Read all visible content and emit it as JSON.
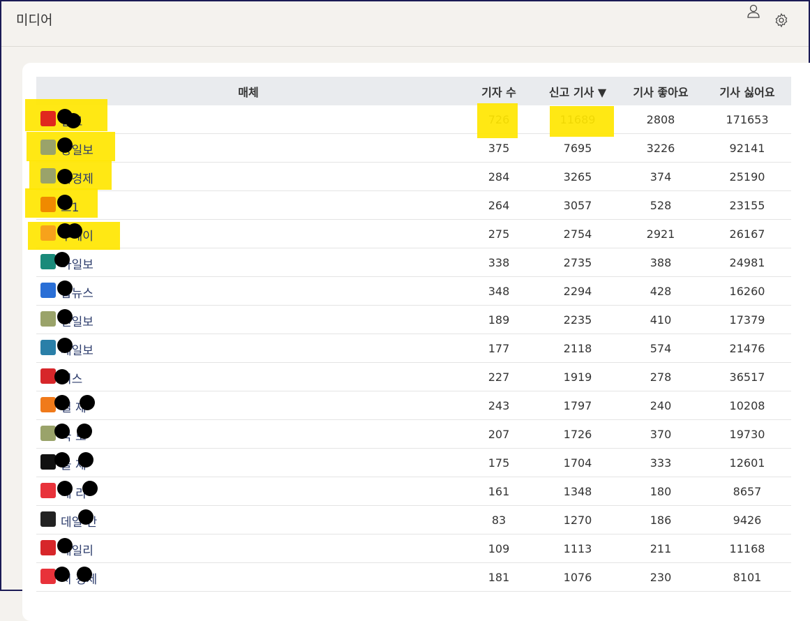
{
  "header": {
    "title": "미디어"
  },
  "table": {
    "columns": [
      "매체",
      "기자 수",
      "신고 기사 ▼",
      "기사 좋아요",
      "기사 싫어요"
    ],
    "rows": [
      {
        "name": "일보",
        "logo_color": "#e0281e",
        "reporters": "726",
        "reports": "11689",
        "likes": "2808",
        "dislikes": "171653"
      },
      {
        "name": "앙일보",
        "logo_color": "#9aa36a",
        "reporters": "375",
        "reports": "7695",
        "likes": "3226",
        "dislikes": "92141"
      },
      {
        "name": "국경제",
        "logo_color": "#9aa36a",
        "reporters": "284",
        "reports": "3265",
        "likes": "374",
        "dislikes": "25190"
      },
      {
        "name": "스1",
        "logo_color": "#f08a00",
        "reporters": "264",
        "reports": "3057",
        "likes": "528",
        "dislikes": "23155"
      },
      {
        "name": "투데이",
        "logo_color": "#f7a21b",
        "reporters": "275",
        "reports": "2754",
        "likes": "2921",
        "dislikes": "26167"
      },
      {
        "name": "아일보",
        "logo_color": "#1a8a7a",
        "reporters": "338",
        "reports": "2735",
        "likes": "388",
        "dislikes": "24981"
      },
      {
        "name": "합뉴스",
        "logo_color": "#2a6fd6",
        "reporters": "348",
        "reports": "2294",
        "likes": "428",
        "dislikes": "16260"
      },
      {
        "name": "민일보",
        "logo_color": "#9aa36a",
        "reporters": "189",
        "reports": "2235",
        "likes": "410",
        "dislikes": "17379"
      },
      {
        "name": "계일보",
        "logo_color": "#2a7fa8",
        "reporters": "177",
        "reports": "2118",
        "likes": "574",
        "dislikes": "21476"
      },
      {
        "name": "시스",
        "logo_color": "#d7262a",
        "reporters": "227",
        "reports": "1919",
        "likes": "278",
        "dislikes": "36517"
      },
      {
        "name": "일 제",
        "logo_color": "#f07a1a",
        "reporters": "243",
        "reports": "1797",
        "likes": "240",
        "dislikes": "10208"
      },
      {
        "name": "국 보",
        "logo_color": "#9aa36a",
        "reporters": "207",
        "reports": "1726",
        "likes": "370",
        "dislikes": "19730"
      },
      {
        "name": "울 제",
        "logo_color": "#111111",
        "reporters": "175",
        "reports": "1704",
        "likes": "333",
        "dislikes": "12601"
      },
      {
        "name": "데 리",
        "logo_color": "#e8323a",
        "reporters": "161",
        "reports": "1348",
        "likes": "180",
        "dislikes": "8657"
      },
      {
        "name": "데일 안",
        "logo_color": "#222222",
        "reporters": "83",
        "reports": "1270",
        "likes": "186",
        "dislikes": "9426"
      },
      {
        "name": "데일리",
        "logo_color": "#d7262a",
        "reporters": "109",
        "reports": "1113",
        "likes": "211",
        "dislikes": "11168"
      },
      {
        "name": "시 경제",
        "logo_color": "#e8323a",
        "reporters": "181",
        "reports": "1076",
        "likes": "230",
        "dislikes": "8101"
      }
    ]
  },
  "colors": {
    "highlight": "#ffe600",
    "header_bg": "#e9ebee",
    "page_bg": "#f4f2ee"
  },
  "icons": {
    "user": "user-icon",
    "settings": "gear-icon"
  }
}
